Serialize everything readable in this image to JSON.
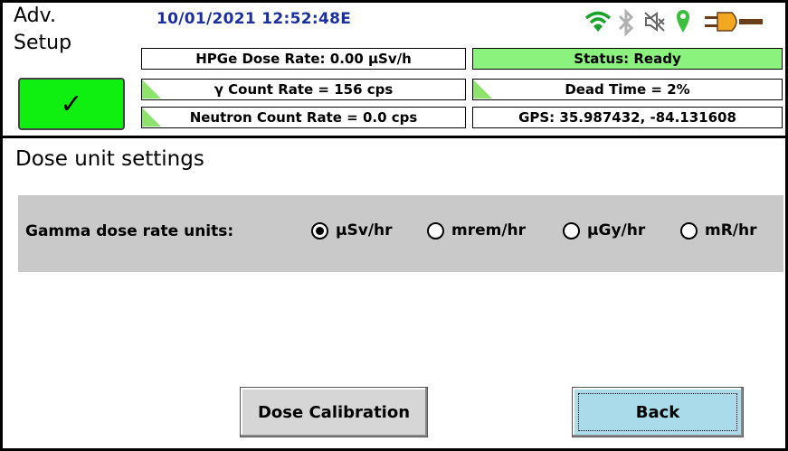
{
  "header": {
    "title_line1": "Adv.",
    "title_line2": "Setup",
    "datetime": "10/01/2021 12:52:48E",
    "icons": [
      "wifi-icon",
      "bluetooth-icon",
      "speaker-muted-icon",
      "location-pin-icon",
      "power-plug-icon"
    ]
  },
  "readouts": {
    "hpge_dose_rate": "HPGe Dose Rate: 0.00  µSv/h",
    "gamma_count_rate": "γ Count Rate = 156 cps",
    "neutron_count_rate": "Neutron Count Rate = 0.0 cps",
    "status": "Status: Ready",
    "dead_time": "Dead Time = 2%",
    "gps": "GPS: 35.987432, -84.131608"
  },
  "ok_button": {
    "symbol": "✓"
  },
  "section": {
    "title": "Dose unit settings",
    "setting_label": "Gamma dose rate units:",
    "options": [
      "µSv/hr",
      "mrem/hr",
      "µGy/hr",
      "mR/hr"
    ],
    "selected": "µSv/hr"
  },
  "buttons": {
    "dose_calibration": "Dose Calibration",
    "back": "Back"
  },
  "colors": {
    "status_green": "#8cf27e",
    "ok_green": "#10f010",
    "panel_gray": "#c9c9c9",
    "back_blue": "#a9dbea",
    "datetime_blue": "#1b2f9e"
  }
}
